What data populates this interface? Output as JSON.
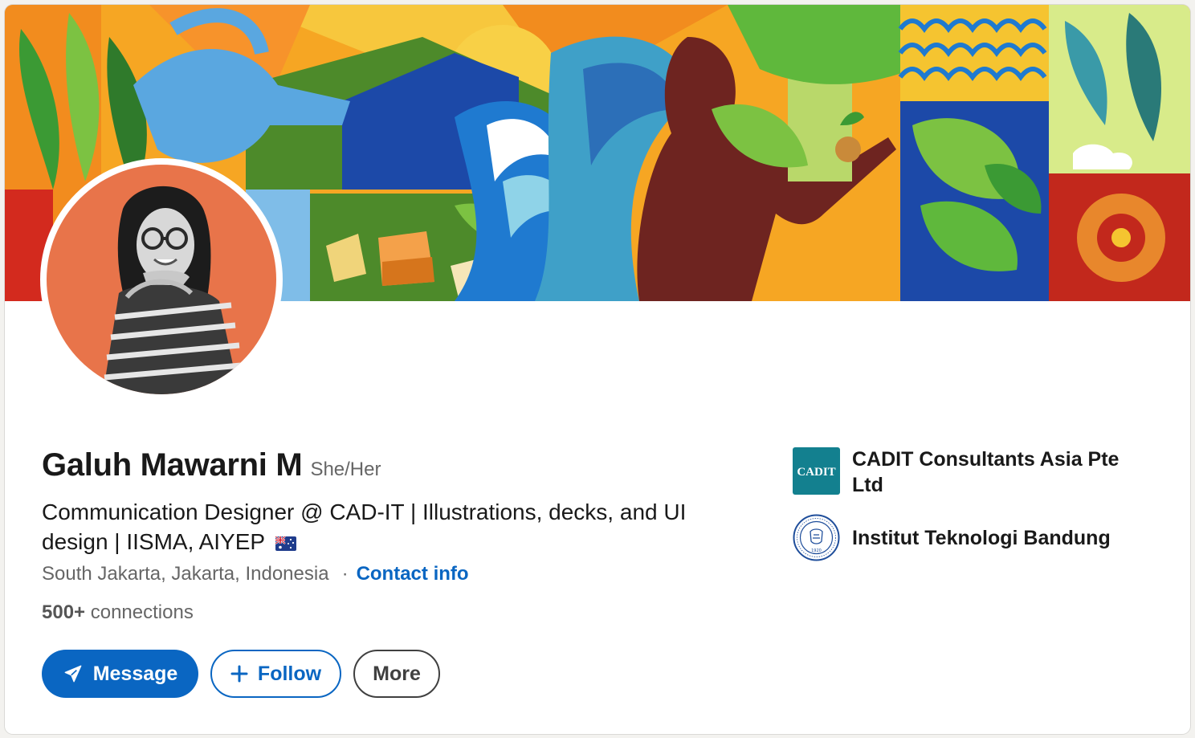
{
  "profile": {
    "name": "Galuh Mawarni M",
    "pronouns": "She/Her",
    "headline": "Communication Designer @ CAD-IT | Illustrations, decks, and UI design | IISMA, AIYEP",
    "location": "South Jakarta, Jakarta, Indonesia",
    "separator": "·",
    "contact_info": "Contact info",
    "connections_count": "500+",
    "connections_label": "connections"
  },
  "actions": {
    "message": "Message",
    "follow": "Follow",
    "more": "More"
  },
  "organizations": [
    {
      "name": "CADIT Consultants Asia Pte Ltd",
      "logo_text": "CADIT",
      "icon": "company-logo"
    },
    {
      "name": "Institut Teknologi Bandung",
      "icon": "school-seal",
      "seal_year": "1920"
    }
  ],
  "colors": {
    "accent": "#0a66c2",
    "avatar_bg": "#e8744a",
    "cadit_teal": "#13808f",
    "itb_blue": "#1f4e9b"
  },
  "icons": {
    "message": "send-icon",
    "follow": "plus-icon",
    "flag": "australia-flag-icon"
  }
}
